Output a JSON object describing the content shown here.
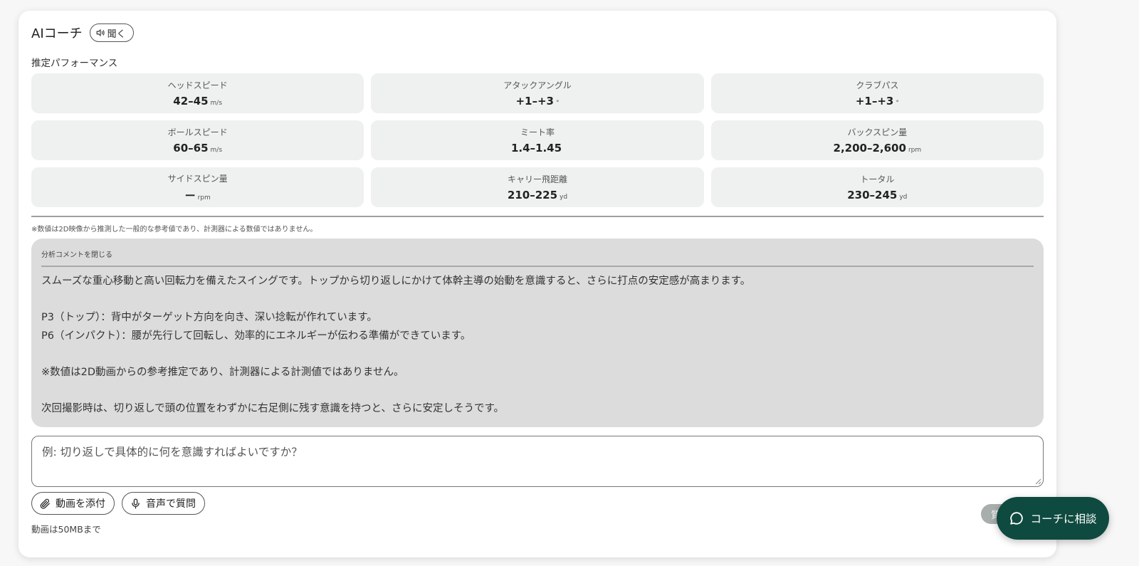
{
  "header": {
    "title": "AIコーチ",
    "listen_label": "聞く"
  },
  "performance": {
    "section_label": "推定パフォーマンス",
    "metrics": [
      {
        "label": "ヘッドスピード",
        "value": "42–45",
        "unit": "m/s"
      },
      {
        "label": "アタックアングル",
        "value": "+1–+3",
        "unit": "°"
      },
      {
        "label": "クラブパス",
        "value": "+1–+3",
        "unit": "°"
      },
      {
        "label": "ボールスピード",
        "value": "60–65",
        "unit": "m/s"
      },
      {
        "label": "ミート率",
        "value": "1.4–1.45",
        "unit": ""
      },
      {
        "label": "バックスピン量",
        "value": "2,200–2,600",
        "unit": "rpm"
      },
      {
        "label": "サイドスピン量",
        "value": "ー",
        "unit": "rpm"
      },
      {
        "label": "キャリー飛距離",
        "value": "210–225",
        "unit": "yd"
      },
      {
        "label": "トータル",
        "value": "230–245",
        "unit": "yd"
      }
    ],
    "note": "※数値は2D映像から推測した一般的な参考値であり、計測器による数値ではありません。"
  },
  "analysis": {
    "toggle_label": "分析コメントを閉じる",
    "line1": "スムーズな重心移動と高い回転力を備えたスイングです。トップから切り返しにかけて体幹主導の始動を意識すると、さらに打点の安定感が高まります。",
    "line2": "P3（トップ）：背中がターゲット方向を向き、深い捻転が作れています。",
    "line3": "P6（インパクト）：腰が先行して回転し、効率的にエネルギーが伝わる準備ができています。",
    "line4": "※数値は2D動画からの参考推定であり、計測器による計測値ではありません。",
    "line5": "次回撮影時は、切り返しで頭の位置をわずかに右足側に残す意識を持つと、さらに安定しそうです。"
  },
  "question": {
    "placeholder": "例: 切り返しで具体的に何を意識すればよいですか？"
  },
  "actions": {
    "attach_label": "動画を添付",
    "voice_label": "音声で質問",
    "limit_text": "動画は50MBまで",
    "submit_label": "質問する"
  },
  "coach_button": {
    "label": "コーチに相談"
  },
  "colors": {
    "accent": "#0e4a3f",
    "card_bg": "#eff0f0",
    "analysis_bg": "#dcdcdc"
  },
  "icons": [
    "speaker-icon",
    "paperclip-icon",
    "microphone-icon",
    "chat-bubble-icon"
  ]
}
